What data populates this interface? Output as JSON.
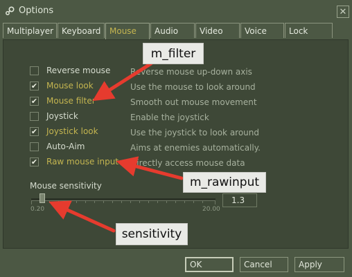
{
  "window": {
    "title": "Options",
    "close_glyph": "✕"
  },
  "tabs": [
    {
      "label": "Multiplayer"
    },
    {
      "label": "Keyboard"
    },
    {
      "label": "Mouse",
      "active": true
    },
    {
      "label": "Audio"
    },
    {
      "label": "Video"
    },
    {
      "label": "Voice"
    },
    {
      "label": "Lock"
    }
  ],
  "options": [
    {
      "label": "Reverse mouse",
      "checked": false,
      "desc": "Reverse mouse up-down axis"
    },
    {
      "label": "Mouse look",
      "checked": true,
      "desc": "Use the mouse to look around"
    },
    {
      "label": "Mouse filter",
      "checked": true,
      "desc": "Smooth out mouse movement"
    },
    {
      "label": "Joystick",
      "checked": false,
      "desc": "Enable the joystick"
    },
    {
      "label": "Joystick look",
      "checked": true,
      "desc": "Use the joystick to look around"
    },
    {
      "label": "Auto-Aim",
      "checked": false,
      "desc": "Aims at enemies automatically."
    },
    {
      "label": "Raw mouse input",
      "checked": true,
      "desc": "Directly access mouse data"
    }
  ],
  "check_glyph": "✔",
  "sensitivity": {
    "label": "Mouse sensitivity",
    "min": "0.20",
    "max": "20.00",
    "value": "1.3"
  },
  "buttons": {
    "ok": "OK",
    "cancel": "Cancel",
    "apply": "Apply"
  },
  "annotations": {
    "filter": "m_filter",
    "rawinput": "m_rawinput",
    "sensitivity": "sensitivity",
    "arrow_color": "#e63b2e"
  },
  "colors": {
    "background": "#4c5844",
    "panel": "#3e4837",
    "checked_label": "#c4b550"
  }
}
